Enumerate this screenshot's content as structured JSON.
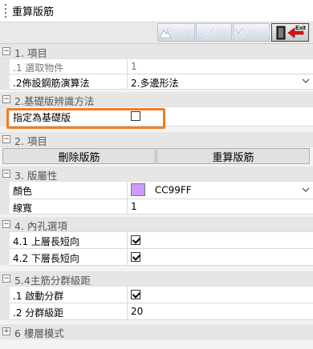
{
  "window": {
    "title": "重算版筋",
    "grip_icon": "drag-grip-icon"
  },
  "toolbar": {
    "apply_label": "Apply",
    "ok_label": "OK",
    "cancel_label": "Cancel",
    "exit_label": "Exit"
  },
  "sections": {
    "s1": {
      "toggle": "−",
      "label": "1. 項目"
    },
    "s2a": {
      "toggle": "−",
      "label": "2.基礎版辨識方法"
    },
    "s2b": {
      "toggle": "−",
      "label": "2. 項目"
    },
    "s3": {
      "toggle": "−",
      "label": "3. 版屬性"
    },
    "s4": {
      "toggle": "−",
      "label": "4. 內孔選項"
    },
    "s5": {
      "toggle": "−",
      "label": "5.4主筋分群級距"
    },
    "s6": {
      "toggle": "+",
      "label": "6 樓層模式"
    }
  },
  "props": {
    "select_count": {
      "name": ".1 選取物件",
      "value": "1"
    },
    "rebar_algo": {
      "name": ".2佈設鋼筋演算法",
      "value": "2.多邊形法"
    },
    "designate_base": {
      "name": "指定為基礎版",
      "checked": false
    },
    "color": {
      "name": "顏色",
      "value": "CC99FF",
      "swatch": "#CC99FF"
    },
    "line_width": {
      "name": "線寬",
      "value": "1"
    },
    "top_short": {
      "name": "4.1 上層長短向",
      "checked": true
    },
    "bottom_short": {
      "name": "4.2 下層長短向",
      "checked": true
    },
    "enable_group": {
      "name": ".1 啟動分群",
      "checked": true
    },
    "group_step": {
      "name": ".2 分群級距",
      "value": "20"
    }
  },
  "buttons": {
    "delete_rebar": "刪除版筋",
    "recalc_rebar": "重算版筋"
  },
  "colors": {
    "highlight": "#f07e25",
    "category_bg": "#e6e6e6"
  }
}
